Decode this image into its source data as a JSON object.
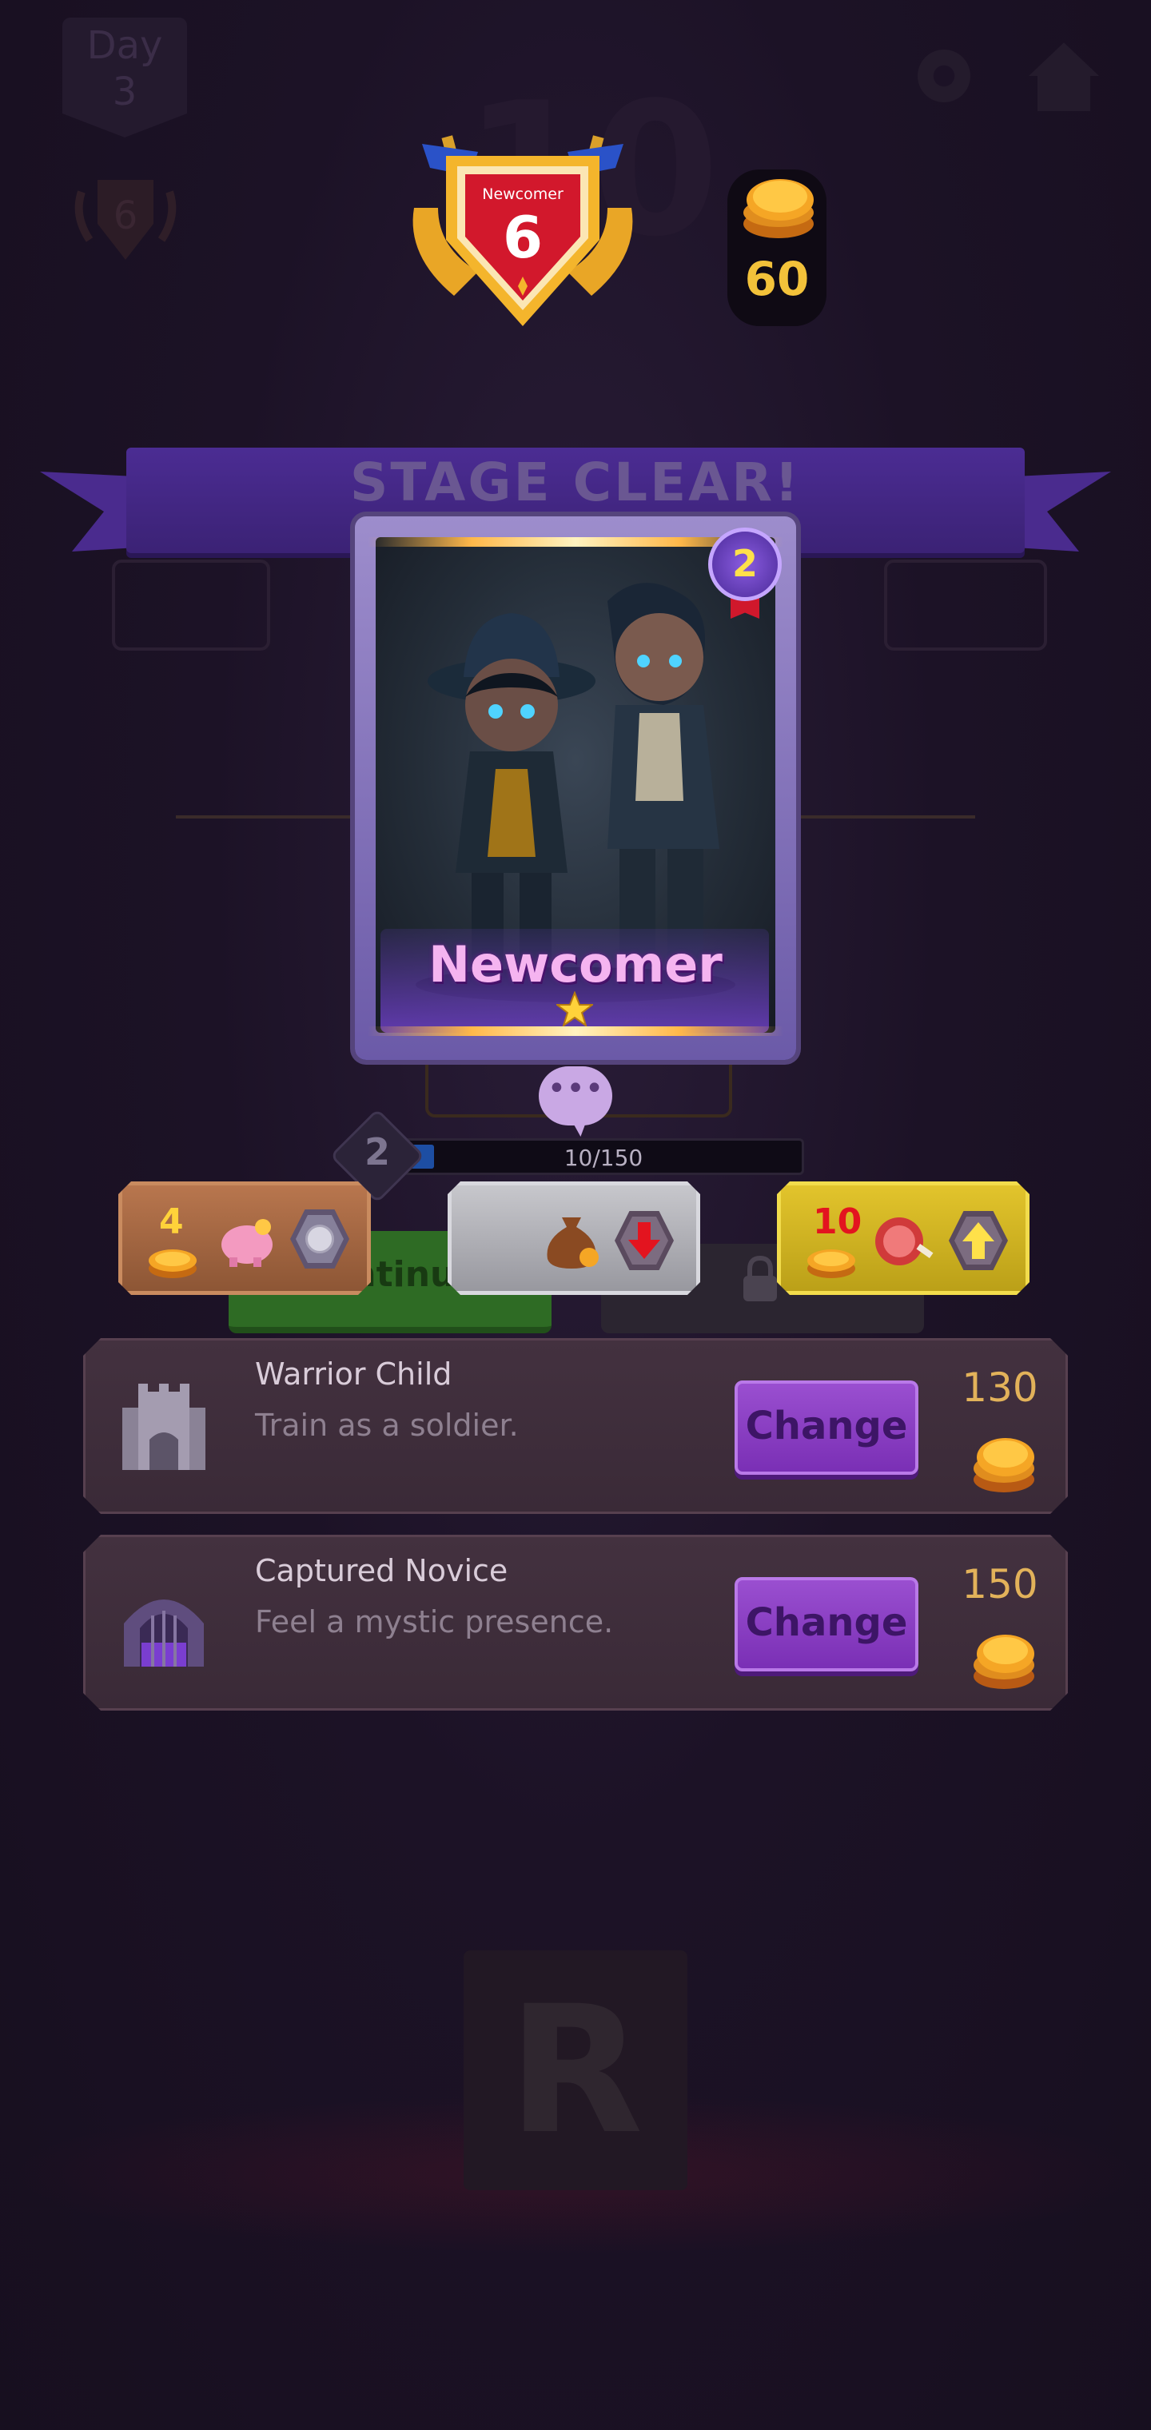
{
  "background": {
    "day_label": "Day",
    "day_number": "3",
    "shield_number": "6",
    "big_number": "10",
    "letter": "R"
  },
  "rank_badge": {
    "title": "Newcomer",
    "level": "6"
  },
  "coins": {
    "count": "60"
  },
  "banner": {
    "text": "STAGE CLEAR!"
  },
  "card": {
    "name": "Newcomer",
    "level": "2",
    "stars": 1
  },
  "speech_bubble": {
    "text": "•••"
  },
  "xp": {
    "level": "2",
    "text": "10/150",
    "current": 10,
    "max": 150
  },
  "options": [
    {
      "number": "4",
      "color": "#a86a44",
      "icons": [
        "coin-stack-icon",
        "piggy-bank-icon",
        "disc-icon"
      ]
    },
    {
      "number": "",
      "color": "#b3b3b8",
      "icons": [
        "money-bag-icon",
        "arrow-down-icon"
      ]
    },
    {
      "number": "10",
      "color": "#d3b424",
      "icons": [
        "coin-stack-icon",
        "meat-icon",
        "arrow-up-icon"
      ]
    }
  ],
  "continue_button": {
    "label": "Continue"
  },
  "jobs": [
    {
      "title": "Warrior Child",
      "subtitle": "Train as a soldier.",
      "button": "Change",
      "price": "130",
      "icon": "castle-icon"
    },
    {
      "title": "Captured Novice",
      "subtitle": "Feel a mystic presence.",
      "button": "Change",
      "price": "150",
      "icon": "dungeon-gate-icon"
    }
  ],
  "colors": {
    "accent_purple": "#8a43c8",
    "coin_gold": "#f3c23a",
    "background": "#1c1226"
  }
}
